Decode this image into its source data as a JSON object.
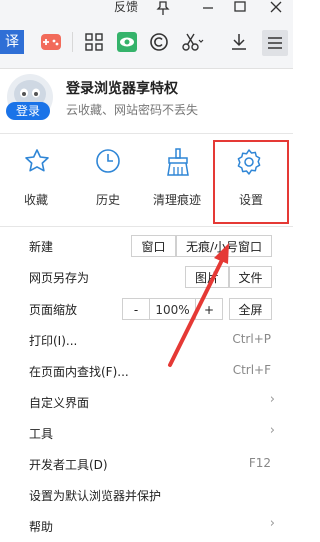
{
  "titlebar": {
    "feedback_label": "反馈",
    "icons": [
      "pin-icon",
      "minimize-icon",
      "maximize-icon",
      "close-icon"
    ]
  },
  "toolbar": {
    "translate_label": "译",
    "icons": [
      "game-icon",
      "apps-grid-icon",
      "eye-protect-icon",
      "c-circle-icon",
      "scissors-icon",
      "download-icon",
      "menu-icon"
    ]
  },
  "user": {
    "title": "登录浏览器享特权",
    "subtitle": "云收藏、网站密码不丢失",
    "login_label": "登录"
  },
  "quick_actions": [
    {
      "label": "收藏",
      "icon": "star-icon"
    },
    {
      "label": "历史",
      "icon": "clock-icon"
    },
    {
      "label": "清理痕迹",
      "icon": "broom-icon"
    },
    {
      "label": "设置",
      "icon": "gear-icon"
    }
  ],
  "menu": {
    "new": {
      "label": "新建",
      "window": "窗口",
      "incognito": "无痕/小号窗口"
    },
    "save_as": {
      "label": "网页另存为",
      "image": "图片",
      "file": "文件"
    },
    "zoom": {
      "label": "页面缩放",
      "minus": "-",
      "value": "100%",
      "plus": "+",
      "fullscreen": "全屏"
    },
    "print": {
      "label": "打印(I)...",
      "shortcut": "Ctrl+P"
    },
    "find": {
      "label": "在页面内查找(F)...",
      "shortcut": "Ctrl+F"
    },
    "customize": {
      "label": "自定义界面",
      "chev": "›"
    },
    "tools": {
      "label": "工具",
      "chev": "›"
    },
    "devtools": {
      "label": "开发者工具(D)",
      "shortcut": "F12"
    },
    "default_browser": {
      "label": "设置为默认浏览器并保护"
    },
    "help": {
      "label": "帮助",
      "chev": "›"
    }
  },
  "colors": {
    "accent": "#1a73e8",
    "highlight": "#e53935",
    "icon_blue": "#2f86d6"
  }
}
